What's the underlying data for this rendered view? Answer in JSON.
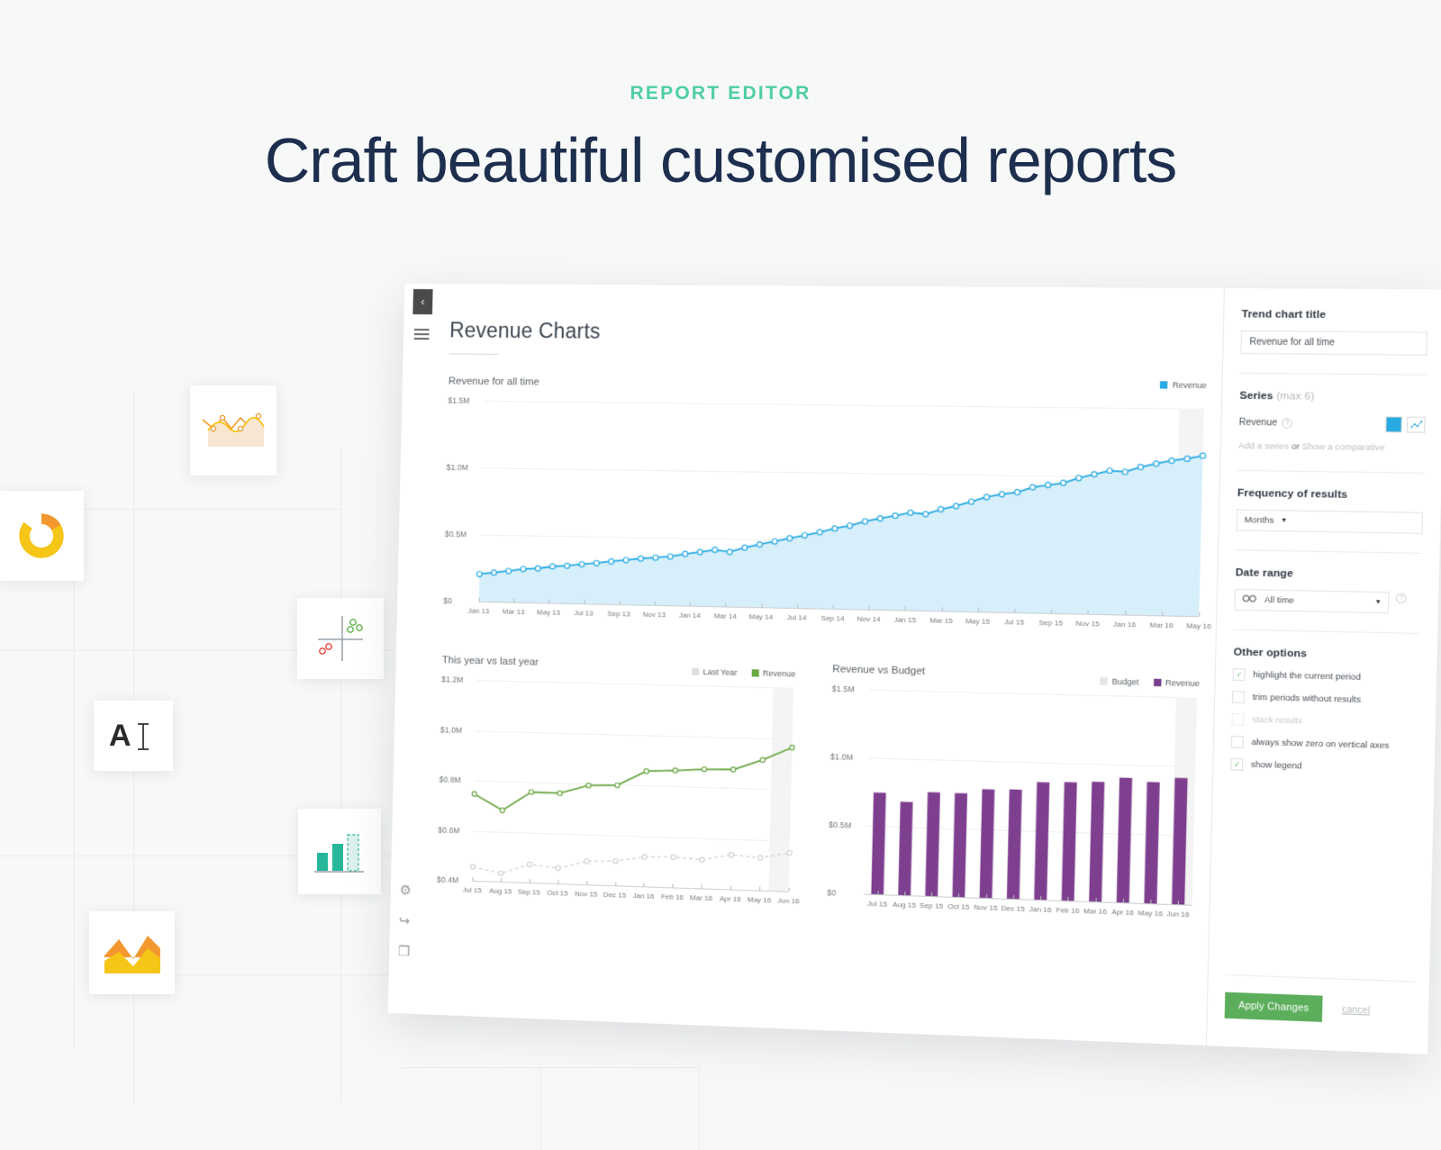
{
  "hero": {
    "eyebrow": "REPORT EDITOR",
    "headline": "Craft beautiful customised reports"
  },
  "palette": {
    "accent_green": "#4ecfa0",
    "headline_navy": "#1d2e4e",
    "series_blue": "#29aae2",
    "series_blue_fill": "#d7effb",
    "series_green": "#6aa845",
    "series_purple": "#7e3f8f",
    "last_year_grey": "#cfd3d6",
    "budget_grey": "#e2e4e6",
    "apply_green": "#5cae5c",
    "icon_yellow": "#f5c518",
    "icon_orange": "#f2982f",
    "icon_teal": "#26b79b",
    "icon_red": "#e8453c"
  },
  "floating_icons": [
    {
      "name": "line-area-chart-icon"
    },
    {
      "name": "donut-chart-icon"
    },
    {
      "name": "scatter-quadrant-chart-icon"
    },
    {
      "name": "text-widget-icon",
      "glyph": "A"
    },
    {
      "name": "bar-target-chart-icon"
    },
    {
      "name": "area-chart-icon"
    }
  ],
  "app": {
    "collapse_label": "‹",
    "report_title": "Revenue Charts",
    "tools": [
      {
        "name": "settings-icon",
        "glyph": "⚙"
      },
      {
        "name": "share-icon",
        "glyph": "↪"
      },
      {
        "name": "export-document-icon",
        "glyph": "❐"
      }
    ]
  },
  "sidebar": {
    "trend_title_label": "Trend chart title",
    "trend_title_value": "Revenue for all time",
    "series_label": "Series",
    "series_max": "(max 6)",
    "series_items": [
      {
        "name": "Revenue",
        "color": "#29aae2",
        "type_icon": "line-chart-icon"
      }
    ],
    "add_series": "Add a series",
    "or": "or",
    "show_comparative": "Show a comparative",
    "frequency_label": "Frequency of results",
    "frequency_value": "Months",
    "date_range_label": "Date range",
    "date_range_value": "All time",
    "date_range_icon": "infinity-icon",
    "other_options_label": "Other options",
    "options": [
      {
        "label": "highlight the current period",
        "checked": true,
        "disabled": false
      },
      {
        "label": "trim periods without results",
        "checked": false,
        "disabled": false
      },
      {
        "label": "stack results",
        "checked": false,
        "disabled": true
      },
      {
        "label": "always show zero on vertical axes",
        "checked": false,
        "disabled": false
      },
      {
        "label": "show legend",
        "checked": true,
        "disabled": false
      }
    ],
    "apply_label": "Apply Changes",
    "cancel_label": "cancel"
  },
  "chart_data": [
    {
      "type": "area",
      "id": "revenue-all-time",
      "title": "Revenue for all time",
      "ylabel": "",
      "xlabel": "",
      "ylim": [
        0,
        1500000
      ],
      "ytick_labels": [
        "$1.5M",
        "$1.0M",
        "$0.5M",
        "$0"
      ],
      "yticks": [
        1500000,
        1000000,
        500000,
        0
      ],
      "grid": true,
      "legend": [
        "Revenue"
      ],
      "legend_position": "top-right",
      "series": [
        {
          "name": "Revenue",
          "color": "#29aae2",
          "fill": "#d7effb",
          "values": [
            205000,
            218000,
            232000,
            249000,
            255000,
            272000,
            279000,
            293000,
            303000,
            318000,
            330000,
            343000,
            352000,
            362000,
            383000,
            399000,
            417000,
            404000,
            437000,
            463000,
            487000,
            512000,
            536000,
            560000,
            590000,
            612000,
            646000,
            669000,
            691000,
            715000,
            706000,
            743000,
            769000,
            803000,
            838000,
            860000,
            876000,
            914000,
            932000,
            949000,
            987000,
            1015000,
            1043000,
            1036000,
            1072000,
            1098000,
            1122000,
            1137000,
            1160000
          ]
        }
      ],
      "xtick_labels": [
        "Jan 13",
        "Mar 13",
        "May 13",
        "Jul 13",
        "Sep 13",
        "Nov 13",
        "Jan 14",
        "Mar 14",
        "May 14",
        "Jul 14",
        "Sep 14",
        "Nov 14",
        "Jan 15",
        "Mar 15",
        "May 15",
        "Jul 15",
        "Sep 15",
        "Nov 15",
        "Jan 16",
        "Mar 16",
        "May 16"
      ]
    },
    {
      "type": "line",
      "id": "this-year-vs-last-year",
      "title": "This year vs last year",
      "ylim": [
        400000,
        1200000
      ],
      "ytick_labels": [
        "$1.2M",
        "$1.0M",
        "$0.8M",
        "$0.6M",
        "$0.4M"
      ],
      "yticks": [
        1200000,
        1000000,
        800000,
        600000,
        400000
      ],
      "grid": true,
      "legend": [
        "Last Year",
        "Revenue"
      ],
      "legend_position": "top-right",
      "categories": [
        "Jul 15",
        "Aug 15",
        "Sep 15",
        "Oct 15",
        "Nov 15",
        "Dec 15",
        "Jan 16",
        "Feb 16",
        "Mar 16",
        "Apr 16",
        "May 16",
        "Jun 16"
      ],
      "series": [
        {
          "name": "Last Year",
          "color": "#cfd3d6",
          "style": "dashed",
          "values": [
            455000,
            433000,
            472000,
            461000,
            492000,
            497000,
            516000,
            520000,
            513000,
            536000,
            528000,
            551000
          ]
        },
        {
          "name": "Revenue",
          "color": "#6aa845",
          "style": "solid",
          "values": [
            746000,
            684000,
            760000,
            759000,
            793000,
            797000,
            856000,
            862000,
            870000,
            872000,
            913000,
            965000
          ]
        }
      ]
    },
    {
      "type": "bar",
      "id": "revenue-vs-budget",
      "title": "Revenue vs Budget",
      "ylim": [
        0,
        1500000
      ],
      "ytick_labels": [
        "$1.5M",
        "$1.0M",
        "$0.5M",
        "$0"
      ],
      "yticks": [
        1500000,
        1000000,
        500000,
        0
      ],
      "grid": true,
      "legend": [
        "Budget",
        "Revenue"
      ],
      "legend_position": "top-right",
      "categories": [
        "Jul 15",
        "Aug 15",
        "Sep 15",
        "Oct 15",
        "Nov 15",
        "Dec 15",
        "Jan 16",
        "Feb 16",
        "Mar 16",
        "Apr 16",
        "May 16",
        "Jun 16"
      ],
      "series": [
        {
          "name": "Revenue",
          "color": "#7e3f8f",
          "values": [
            746000,
            684000,
            760000,
            759000,
            793000,
            797000,
            856000,
            862000,
            870000,
            905000,
            880000,
            915000
          ]
        }
      ]
    }
  ]
}
